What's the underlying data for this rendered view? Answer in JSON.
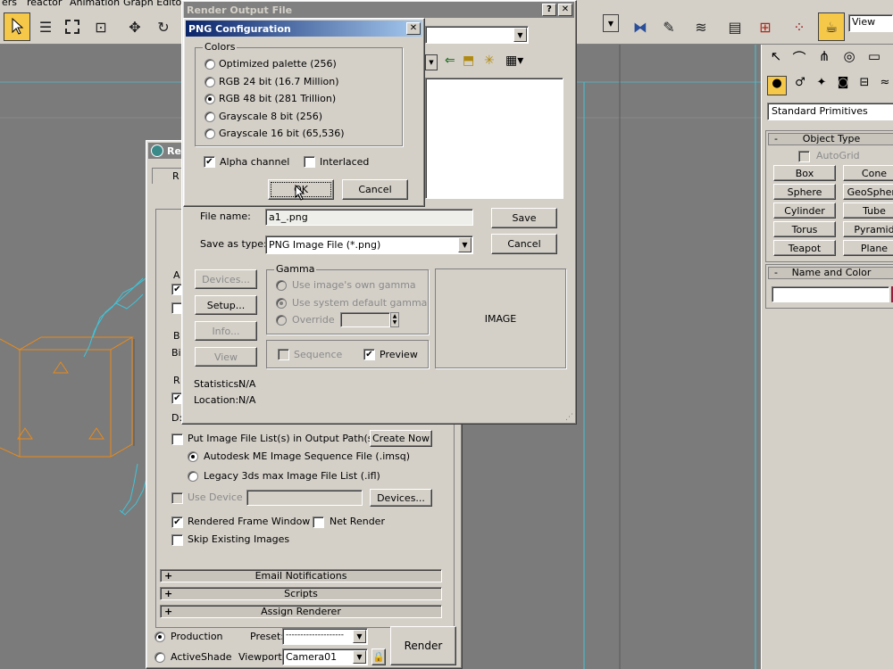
{
  "menubar": {
    "items": [
      "ers",
      "reactor",
      "Animation",
      "Graph Editors"
    ]
  },
  "toolbar": {
    "view_select": "View"
  },
  "command_panel": {
    "category_dropdown": "Standard Primitives",
    "object_type_header": "Object Type",
    "autogrid_label": "AutoGrid",
    "primitives": [
      "Box",
      "Cone",
      "Sphere",
      "GeoSphere",
      "Cylinder",
      "Tube",
      "Torus",
      "Pyramid",
      "Teapot",
      "Plane"
    ],
    "name_color_header": "Name and Color"
  },
  "render_setup": {
    "title": "Re",
    "put_image_list_label": "Put Image File List(s) in Output Path(s)",
    "create_now_button": "Create Now",
    "autodesk_me_label": "Autodesk ME Image Sequence File (.imsq)",
    "legacy_label": "Legacy 3ds max Image File List (.ifl)",
    "use_device_label": "Use Device",
    "devices_button": "Devices...",
    "rendered_frame_window_label": "Rendered Frame Window",
    "net_render_label": "Net Render",
    "skip_existing_label": "Skip Existing Images",
    "rollouts": [
      "Email Notifications",
      "Scripts",
      "Assign Renderer"
    ],
    "production_label": "Production",
    "activeshade_label": "ActiveShade",
    "preset_label": "Preset:",
    "preset_value": "--------------------",
    "viewport_label": "Viewport:",
    "viewport_value": "Camera01",
    "render_button": "Render",
    "left_clipped_labels": [
      "A",
      "B",
      "Bi",
      "R",
      "D:"
    ]
  },
  "render_output": {
    "title": "Render Output File",
    "help_button": "?",
    "close_button": "✕",
    "file_name_label": "File name:",
    "file_name_value": "a1_.png",
    "save_as_type_label": "Save as type:",
    "save_as_type_value": "PNG Image File (*.png)",
    "save_button": "Save",
    "cancel_button": "Cancel",
    "devices_button": "Devices...",
    "setup_button": "Setup...",
    "info_button": "Info...",
    "view_button": "View",
    "gamma_group": "Gamma",
    "use_image_gamma": "Use image's own gamma",
    "use_system_gamma": "Use system default gamma",
    "override_label": "Override",
    "sequence_label": "Sequence",
    "preview_label": "Preview",
    "image_label": "IMAGE",
    "statistics_label": "Statistics:",
    "statistics_value": "N/A",
    "location_label": "Location:",
    "location_value": "N/A"
  },
  "png_config": {
    "title": "PNG Configuration",
    "close_button": "✕",
    "colors_group": "Colors",
    "options": [
      "Optimized palette  (256)",
      "RGB 24 bit  (16.7 Million)",
      "RGB 48 bit  (281 Trillion)",
      "Grayscale 8 bit  (256)",
      "Grayscale 16 bit  (65,536)"
    ],
    "selected_option": "RGB 48 bit  (281 Trillion)",
    "alpha_label": "Alpha channel",
    "alpha_checked": true,
    "interlaced_label": "Interlaced",
    "interlaced_checked": false,
    "ok_button": "OK",
    "cancel_button": "Cancel"
  },
  "colors": {
    "viewport_bg": "#7b7b7b",
    "dialog_bg": "#d4d0c8",
    "title_active": "#0a246a",
    "title_inactive": "#808080",
    "wire_orange": "#e88a1a",
    "wire_cyan": "#3fc4d8"
  }
}
